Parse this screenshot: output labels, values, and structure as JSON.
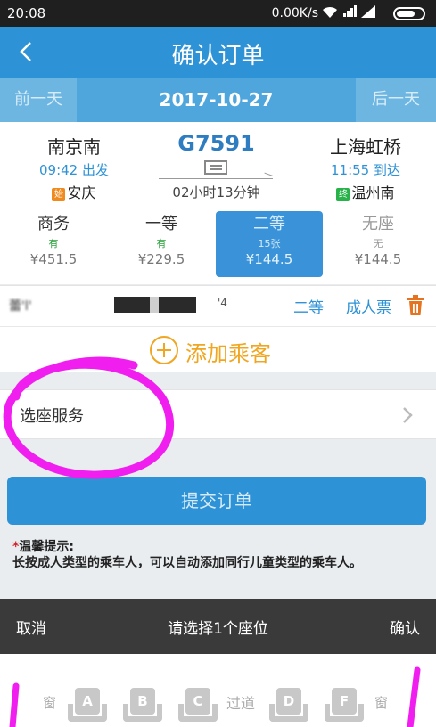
{
  "status_bar": {
    "time": "20:08",
    "speed": "0.00K/s",
    "sig_top": "4G",
    "sig_bottom": "1X"
  },
  "header": {
    "title": "确认订单"
  },
  "date_bar": {
    "prev_label": "前一天",
    "date": "2017-10-27",
    "next_label": "后一天"
  },
  "trip": {
    "from": {
      "name": "南京南",
      "time": "09:42 出发",
      "tag": "始",
      "origin": "安庆"
    },
    "to": {
      "name": "上海虹桥",
      "time": "11:55 到达",
      "tag": "终",
      "terminal": "温州南"
    },
    "train_no": "G7591",
    "duration": "02小时13分钟"
  },
  "seat_classes": [
    {
      "name": "商务",
      "availability": "有",
      "price": "¥451.5"
    },
    {
      "name": "一等",
      "availability": "有",
      "price": "¥229.5"
    },
    {
      "name": "二等",
      "availability": "15张",
      "price": "¥144.5"
    },
    {
      "name": "无座",
      "availability": "无",
      "price": "¥144.5"
    }
  ],
  "passenger": {
    "name": "蕾'l'",
    "id_tail": "'4",
    "seat_type": "二等",
    "ticket_type": "成人票"
  },
  "add_passenger": {
    "label": "添加乘客"
  },
  "seat_service": {
    "label": "选座服务"
  },
  "submit": {
    "label": "提交订单"
  },
  "tip": {
    "title": "温馨提示:",
    "body": "长按成人类型的乘车人，可以自动添加同行儿童类型的乘车人。"
  },
  "seat_picker": {
    "cancel": "取消",
    "title": "请选择1个座位",
    "confirm": "确认",
    "window_label": "窗",
    "aisle_label": "过道",
    "seats": [
      "A",
      "B",
      "C",
      "D",
      "F"
    ]
  },
  "colors": {
    "primary": "#2e92d6",
    "accent": "#f0a620",
    "annotation": "#f01ff0"
  }
}
